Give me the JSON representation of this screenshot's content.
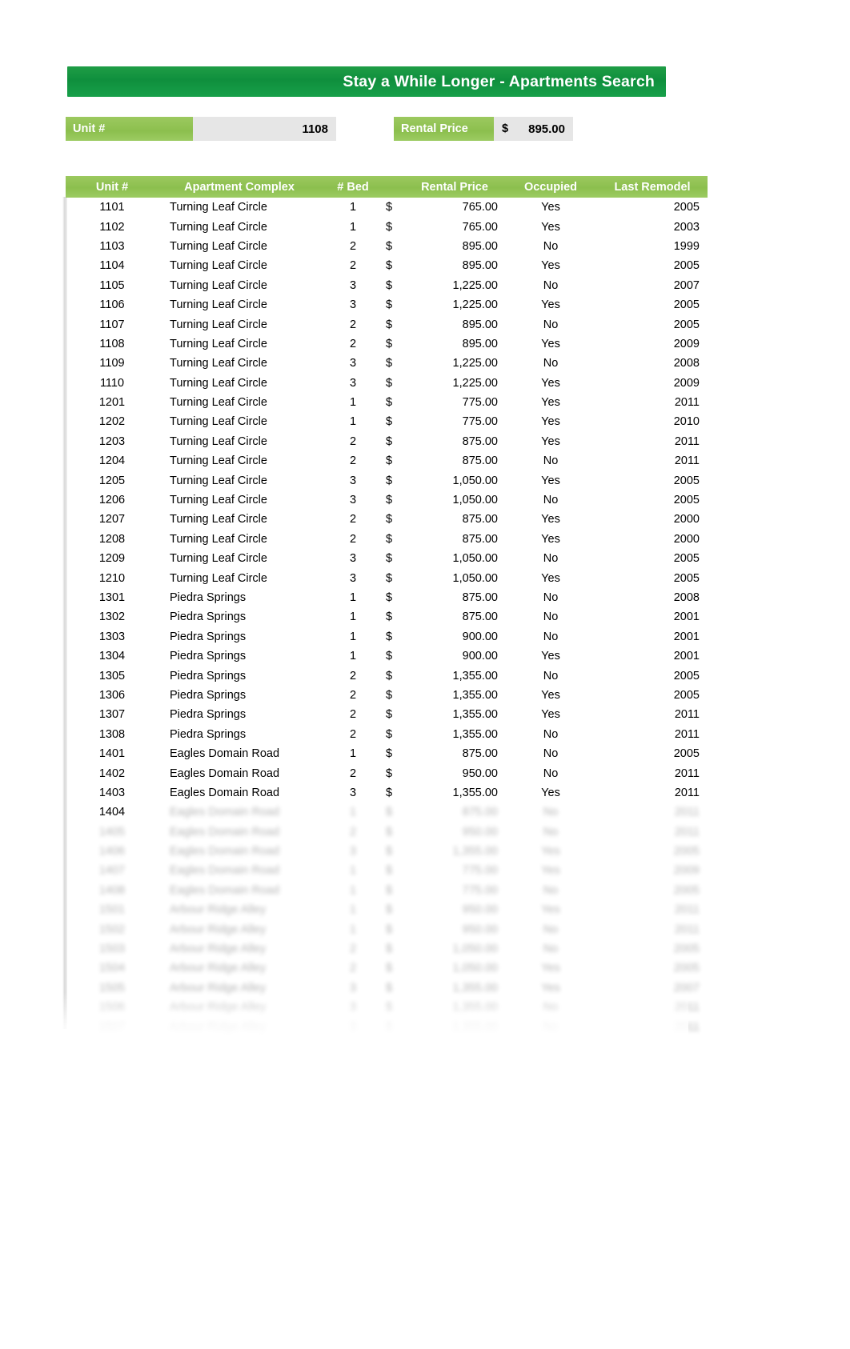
{
  "header": {
    "title": "Stay a While Longer - Apartments Search"
  },
  "criteria": {
    "unit": {
      "label": "Unit #",
      "value": "1108"
    },
    "rental_price": {
      "label": "Rental Price",
      "currency_symbol": "$",
      "value": "895.00"
    }
  },
  "table": {
    "columns": [
      "Unit #",
      "Apartment Complex",
      "# Bed",
      "",
      "Rental Price",
      "Occupied",
      "Last Remodel"
    ],
    "currency_symbol": "$",
    "rows": [
      {
        "unit": "1101",
        "complex": "Turning Leaf Circle",
        "bed": "1",
        "cur": "$",
        "price": "765.00",
        "occupied": "Yes",
        "remodel": "2005",
        "faded": false
      },
      {
        "unit": "1102",
        "complex": "Turning Leaf Circle",
        "bed": "1",
        "cur": "$",
        "price": "765.00",
        "occupied": "Yes",
        "remodel": "2003",
        "faded": false
      },
      {
        "unit": "1103",
        "complex": "Turning Leaf Circle",
        "bed": "2",
        "cur": "$",
        "price": "895.00",
        "occupied": "No",
        "remodel": "1999",
        "faded": false
      },
      {
        "unit": "1104",
        "complex": "Turning Leaf Circle",
        "bed": "2",
        "cur": "$",
        "price": "895.00",
        "occupied": "Yes",
        "remodel": "2005",
        "faded": false
      },
      {
        "unit": "1105",
        "complex": "Turning Leaf Circle",
        "bed": "3",
        "cur": "$",
        "price": "1,225.00",
        "occupied": "No",
        "remodel": "2007",
        "faded": false
      },
      {
        "unit": "1106",
        "complex": "Turning Leaf Circle",
        "bed": "3",
        "cur": "$",
        "price": "1,225.00",
        "occupied": "Yes",
        "remodel": "2005",
        "faded": false
      },
      {
        "unit": "1107",
        "complex": "Turning Leaf Circle",
        "bed": "2",
        "cur": "$",
        "price": "895.00",
        "occupied": "No",
        "remodel": "2005",
        "faded": false
      },
      {
        "unit": "1108",
        "complex": "Turning Leaf Circle",
        "bed": "2",
        "cur": "$",
        "price": "895.00",
        "occupied": "Yes",
        "remodel": "2009",
        "faded": false
      },
      {
        "unit": "1109",
        "complex": "Turning Leaf Circle",
        "bed": "3",
        "cur": "$",
        "price": "1,225.00",
        "occupied": "No",
        "remodel": "2008",
        "faded": false
      },
      {
        "unit": "1110",
        "complex": "Turning Leaf Circle",
        "bed": "3",
        "cur": "$",
        "price": "1,225.00",
        "occupied": "Yes",
        "remodel": "2009",
        "faded": false
      },
      {
        "unit": "1201",
        "complex": "Turning Leaf Circle",
        "bed": "1",
        "cur": "$",
        "price": "775.00",
        "occupied": "Yes",
        "remodel": "2011",
        "faded": false
      },
      {
        "unit": "1202",
        "complex": "Turning Leaf Circle",
        "bed": "1",
        "cur": "$",
        "price": "775.00",
        "occupied": "Yes",
        "remodel": "2010",
        "faded": false
      },
      {
        "unit": "1203",
        "complex": "Turning Leaf Circle",
        "bed": "2",
        "cur": "$",
        "price": "875.00",
        "occupied": "Yes",
        "remodel": "2011",
        "faded": false
      },
      {
        "unit": "1204",
        "complex": "Turning Leaf Circle",
        "bed": "2",
        "cur": "$",
        "price": "875.00",
        "occupied": "No",
        "remodel": "2011",
        "faded": false
      },
      {
        "unit": "1205",
        "complex": "Turning Leaf Circle",
        "bed": "3",
        "cur": "$",
        "price": "1,050.00",
        "occupied": "Yes",
        "remodel": "2005",
        "faded": false
      },
      {
        "unit": "1206",
        "complex": "Turning Leaf Circle",
        "bed": "3",
        "cur": "$",
        "price": "1,050.00",
        "occupied": "No",
        "remodel": "2005",
        "faded": false
      },
      {
        "unit": "1207",
        "complex": "Turning Leaf Circle",
        "bed": "2",
        "cur": "$",
        "price": "875.00",
        "occupied": "Yes",
        "remodel": "2000",
        "faded": false
      },
      {
        "unit": "1208",
        "complex": "Turning Leaf Circle",
        "bed": "2",
        "cur": "$",
        "price": "875.00",
        "occupied": "Yes",
        "remodel": "2000",
        "faded": false
      },
      {
        "unit": "1209",
        "complex": "Turning Leaf Circle",
        "bed": "3",
        "cur": "$",
        "price": "1,050.00",
        "occupied": "No",
        "remodel": "2005",
        "faded": false
      },
      {
        "unit": "1210",
        "complex": "Turning Leaf Circle",
        "bed": "3",
        "cur": "$",
        "price": "1,050.00",
        "occupied": "Yes",
        "remodel": "2005",
        "faded": false
      },
      {
        "unit": "1301",
        "complex": "Piedra Springs",
        "bed": "1",
        "cur": "$",
        "price": "875.00",
        "occupied": "No",
        "remodel": "2008",
        "faded": false
      },
      {
        "unit": "1302",
        "complex": "Piedra Springs",
        "bed": "1",
        "cur": "$",
        "price": "875.00",
        "occupied": "No",
        "remodel": "2001",
        "faded": false
      },
      {
        "unit": "1303",
        "complex": "Piedra Springs",
        "bed": "1",
        "cur": "$",
        "price": "900.00",
        "occupied": "No",
        "remodel": "2001",
        "faded": false
      },
      {
        "unit": "1304",
        "complex": "Piedra Springs",
        "bed": "1",
        "cur": "$",
        "price": "900.00",
        "occupied": "Yes",
        "remodel": "2001",
        "faded": false
      },
      {
        "unit": "1305",
        "complex": "Piedra Springs",
        "bed": "2",
        "cur": "$",
        "price": "1,355.00",
        "occupied": "No",
        "remodel": "2005",
        "faded": false
      },
      {
        "unit": "1306",
        "complex": "Piedra Springs",
        "bed": "2",
        "cur": "$",
        "price": "1,355.00",
        "occupied": "Yes",
        "remodel": "2005",
        "faded": false
      },
      {
        "unit": "1307",
        "complex": "Piedra Springs",
        "bed": "2",
        "cur": "$",
        "price": "1,355.00",
        "occupied": "Yes",
        "remodel": "2011",
        "faded": false
      },
      {
        "unit": "1308",
        "complex": "Piedra Springs",
        "bed": "2",
        "cur": "$",
        "price": "1,355.00",
        "occupied": "No",
        "remodel": "2011",
        "faded": false
      },
      {
        "unit": "1401",
        "complex": "Eagles Domain Road",
        "bed": "1",
        "cur": "$",
        "price": "875.00",
        "occupied": "No",
        "remodel": "2005",
        "faded": false
      },
      {
        "unit": "1402",
        "complex": "Eagles Domain Road",
        "bed": "2",
        "cur": "$",
        "price": "950.00",
        "occupied": "No",
        "remodel": "2011",
        "faded": false
      },
      {
        "unit": "1403",
        "complex": "Eagles Domain Road",
        "bed": "3",
        "cur": "$",
        "price": "1,355.00",
        "occupied": "Yes",
        "remodel": "2011",
        "faded": false
      },
      {
        "unit": "1404",
        "complex": "Eagles Domain Road",
        "bed": "1",
        "cur": "$",
        "price": "875.00",
        "occupied": "No",
        "remodel": "2011",
        "faded": "partial"
      },
      {
        "unit": "1405",
        "complex": "Eagles Domain Road",
        "bed": "2",
        "cur": "$",
        "price": "950.00",
        "occupied": "No",
        "remodel": "2011",
        "faded": true
      },
      {
        "unit": "1406",
        "complex": "Eagles Domain Road",
        "bed": "3",
        "cur": "$",
        "price": "1,355.00",
        "occupied": "Yes",
        "remodel": "2005",
        "faded": true
      },
      {
        "unit": "1407",
        "complex": "Eagles Domain Road",
        "bed": "1",
        "cur": "$",
        "price": "775.00",
        "occupied": "Yes",
        "remodel": "2009",
        "faded": true
      },
      {
        "unit": "1408",
        "complex": "Eagles Domain Road",
        "bed": "1",
        "cur": "$",
        "price": "775.00",
        "occupied": "No",
        "remodel": "2005",
        "faded": true
      },
      {
        "unit": "1501",
        "complex": "Arbour Ridge Alley",
        "bed": "1",
        "cur": "$",
        "price": "950.00",
        "occupied": "Yes",
        "remodel": "2011",
        "faded": true
      },
      {
        "unit": "1502",
        "complex": "Arbour Ridge Alley",
        "bed": "1",
        "cur": "$",
        "price": "950.00",
        "occupied": "No",
        "remodel": "2011",
        "faded": true
      },
      {
        "unit": "1503",
        "complex": "Arbour Ridge Alley",
        "bed": "2",
        "cur": "$",
        "price": "1,050.00",
        "occupied": "No",
        "remodel": "2005",
        "faded": true
      },
      {
        "unit": "1504",
        "complex": "Arbour Ridge Alley",
        "bed": "2",
        "cur": "$",
        "price": "1,050.00",
        "occupied": "Yes",
        "remodel": "2005",
        "faded": true
      },
      {
        "unit": "1505",
        "complex": "Arbour Ridge Alley",
        "bed": "3",
        "cur": "$",
        "price": "1,355.00",
        "occupied": "Yes",
        "remodel": "2007",
        "faded": true
      },
      {
        "unit": "1506",
        "complex": "Arbour Ridge Alley",
        "bed": "3",
        "cur": "$",
        "price": "1,355.00",
        "occupied": "No",
        "remodel": "2011",
        "faded": true
      },
      {
        "unit": "1507",
        "complex": "Arbour Ridge Alley",
        "bed": "3",
        "cur": "$",
        "price": "1,355.00",
        "occupied": "No",
        "remodel": "2011",
        "faded": true
      }
    ]
  }
}
